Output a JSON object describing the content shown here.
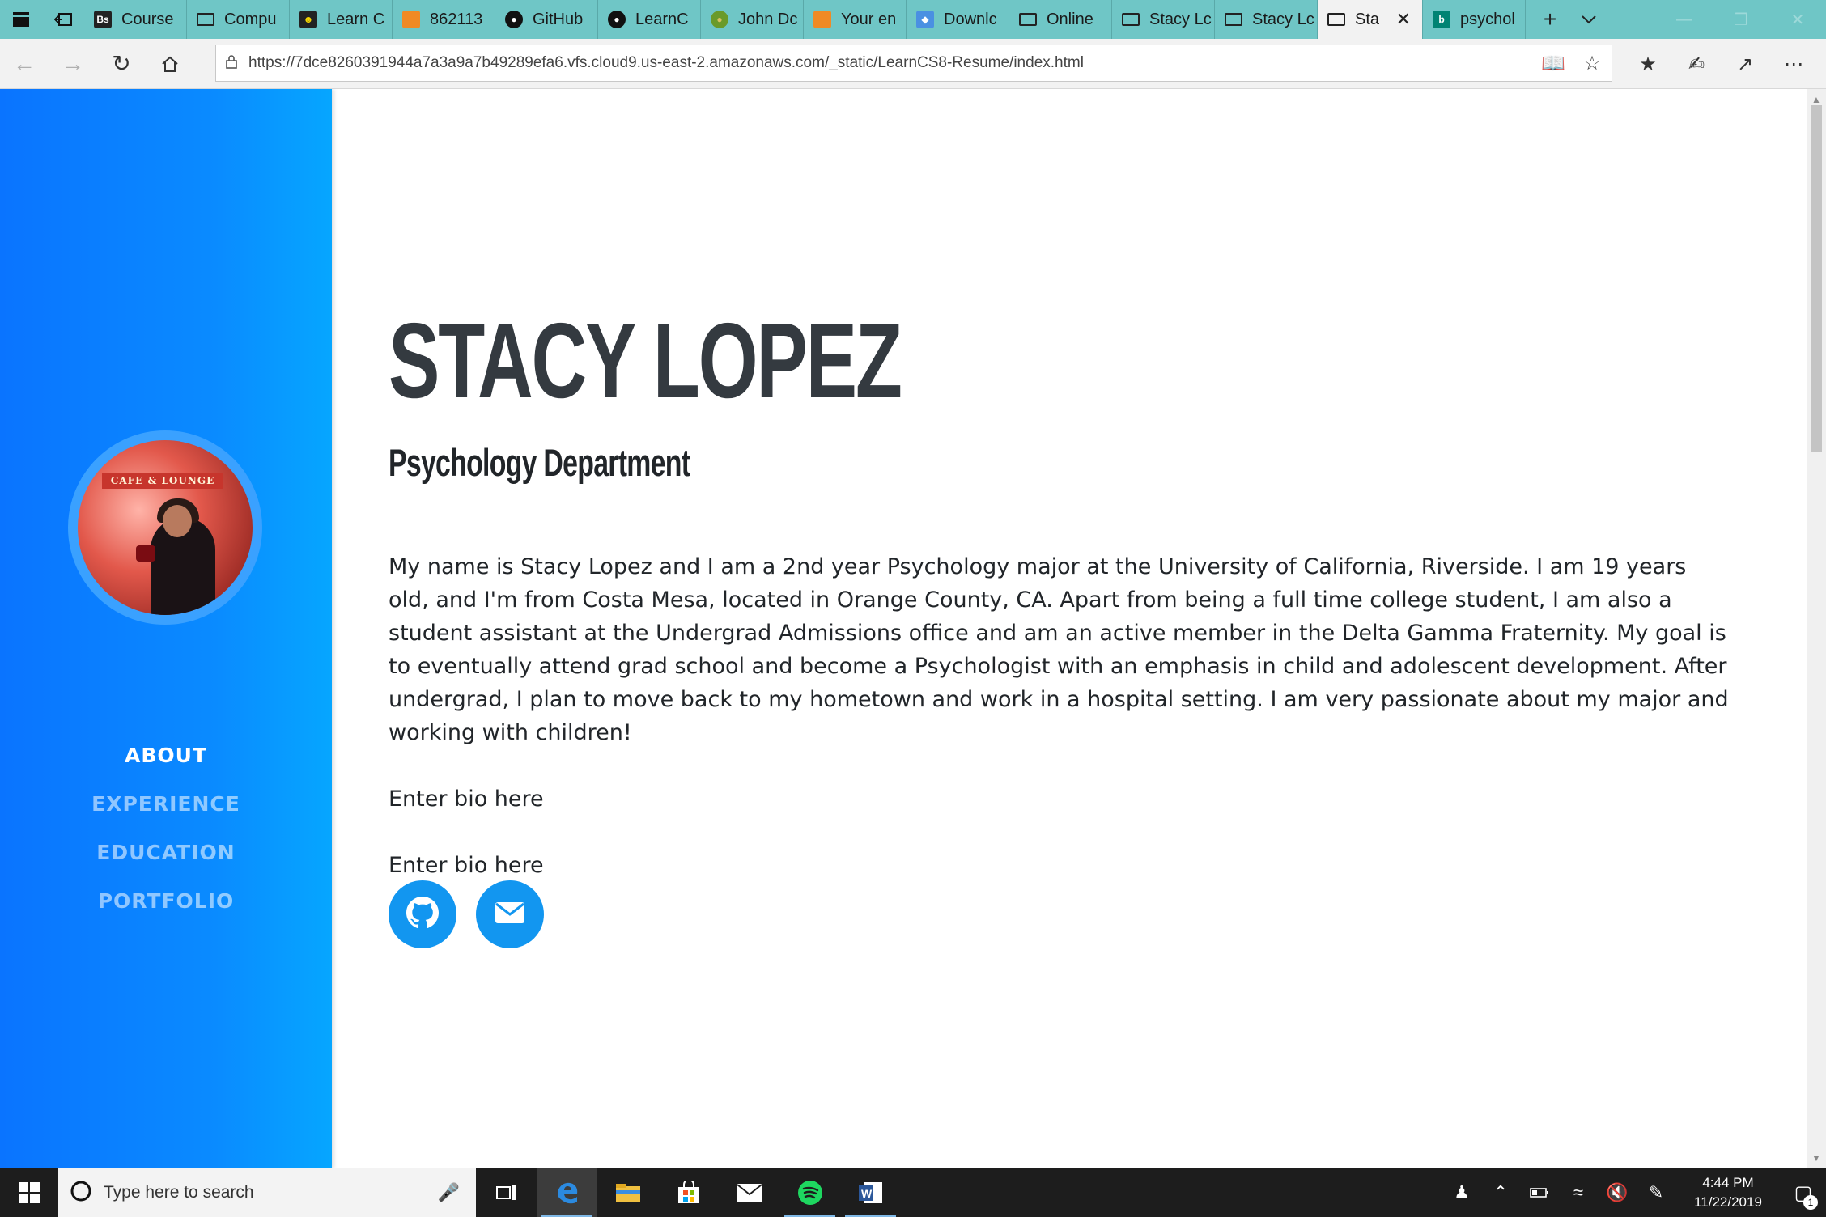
{
  "browser": {
    "tabs": [
      {
        "label": "Course",
        "favicon": "bs-icon"
      },
      {
        "label": "Compu",
        "favicon": "page-icon"
      },
      {
        "label": "Learn C",
        "favicon": "smiley-icon"
      },
      {
        "label": "862113",
        "favicon": "cube-icon"
      },
      {
        "label": "GitHub",
        "favicon": "github-icon"
      },
      {
        "label": "LearnC",
        "favicon": "github-icon"
      },
      {
        "label": "John Dc",
        "favicon": "avocado-icon"
      },
      {
        "label": "Your en",
        "favicon": "cube-icon"
      },
      {
        "label": "Downlc",
        "favicon": "gem-icon"
      },
      {
        "label": "Online",
        "favicon": "page-icon"
      },
      {
        "label": "Stacy Lc",
        "favicon": "page-icon"
      },
      {
        "label": "Stacy Lc",
        "favicon": "page-icon"
      },
      {
        "label": "Sta",
        "favicon": "page-icon",
        "active": true
      },
      {
        "label": "psychol",
        "favicon": "bing-icon"
      }
    ],
    "url": "https://7dce8260391944a7a3a9a7b49289efa6.vfs.cloud9.us-east-2.amazonaws.com/_static/LearnCS8-Resume/index.html"
  },
  "sidebar": {
    "avatar_sign": "CAFE & LOUNGE",
    "nav": [
      {
        "label": "ABOUT",
        "active": true
      },
      {
        "label": "EXPERIENCE",
        "active": false
      },
      {
        "label": "EDUCATION",
        "active": false
      },
      {
        "label": "PORTFOLIO",
        "active": false
      }
    ]
  },
  "main": {
    "name": "STACY LOPEZ",
    "department": "Psychology Department",
    "bio_paragraphs": [
      "My name is Stacy Lopez and I am a 2nd year Psychology major at the University of California, Riverside. I am 19 years old, and I'm from Costa Mesa, located in Orange County, CA. Apart from being a full time college student, I am also a student assistant at the Undergrad Admissions office and am an active member in the Delta Gamma Fraternity. My goal is to eventually attend grad school and become a Psychologist with an emphasis in child and adolescent development. After undergrad, I plan to move back to my hometown and work in a hospital setting. I am very passionate about my major and working with children!",
      "Enter bio here",
      "Enter bio here"
    ],
    "social": [
      {
        "name": "github-icon"
      },
      {
        "name": "envelope-icon"
      }
    ],
    "colors": {
      "sidebar": "#0a8bff",
      "accent": "#1296f0",
      "heading": "#343a40"
    }
  },
  "taskbar": {
    "search_placeholder": "Type here to search",
    "time": "4:44 PM",
    "date": "11/22/2019",
    "notification_count": "1"
  }
}
